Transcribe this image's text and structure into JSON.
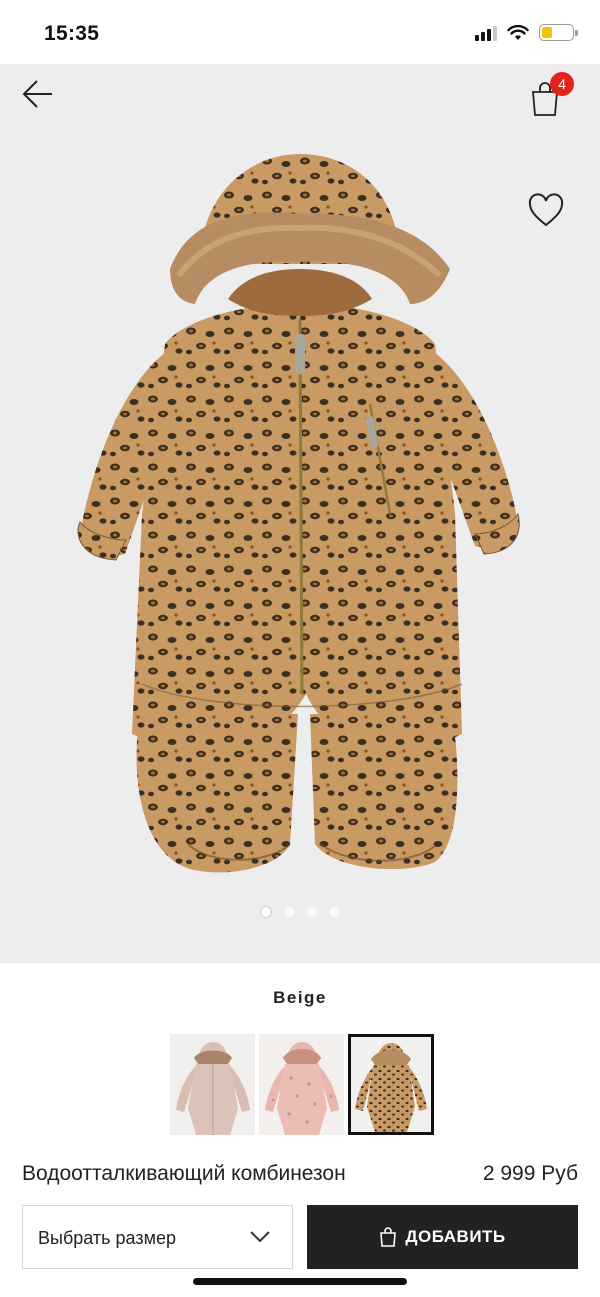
{
  "status_bar": {
    "time": "15:35",
    "battery_level_pct": 36,
    "battery_color": "#f5c400",
    "icons": [
      "signal-icon",
      "wifi-icon",
      "battery-icon"
    ]
  },
  "header": {
    "back_icon": "arrow-left-icon",
    "cart_icon": "shopping-bag-icon",
    "cart_count": "4",
    "badge_color": "#e2231a",
    "favorite_icon": "heart-outline-icon"
  },
  "gallery": {
    "image": "leopard-print-snowsuit-with-fur-trim-hood",
    "image_count": 4,
    "active_index": 0
  },
  "product": {
    "color_name": "Beige",
    "swatches": [
      {
        "color": "light-pink",
        "selected": false
      },
      {
        "color": "pink-print",
        "selected": false
      },
      {
        "color": "beige-leopard",
        "selected": true
      }
    ],
    "title": "Водоотталкивающий комбинезон",
    "price": "2 999 Руб"
  },
  "actions": {
    "size_select_label": "Выбрать размер",
    "add_button_label": "ДОБАВИТЬ",
    "add_button_color": "#222222"
  }
}
